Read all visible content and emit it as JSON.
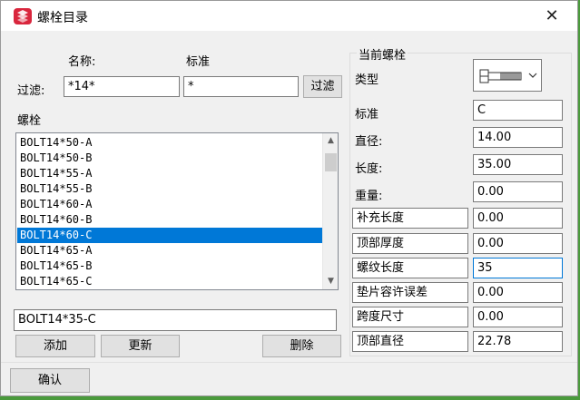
{
  "window": {
    "title": "螺栓目录",
    "close_symbol": "✕"
  },
  "filter": {
    "name_header": "名称:",
    "standard_header": "标准",
    "label": "过滤:",
    "name_value": "*14*",
    "standard_value": "*",
    "button": "过滤"
  },
  "bolts": {
    "label": "螺栓",
    "items": [
      "BOLT14*50-A",
      "BOLT14*50-B",
      "BOLT14*55-A",
      "BOLT14*55-B",
      "BOLT14*60-A",
      "BOLT14*60-B",
      "BOLT14*60-C",
      "BOLT14*65-A",
      "BOLT14*65-B",
      "BOLT14*65-C"
    ],
    "selected_index": 6,
    "current_name": "BOLT14*35-C"
  },
  "actions": {
    "add": "添加",
    "update": "更新",
    "delete": "删除",
    "confirm": "确认"
  },
  "current": {
    "group_title": "当前螺栓",
    "type_label": "类型",
    "type_icon": "bolt-icon",
    "standard_label": "标准",
    "standard_value": "C",
    "diameter_label": "直径:",
    "diameter_value": "14.00",
    "length_label": "长度:",
    "length_value": "35.00",
    "weight_label": "重量:",
    "weight_value": "0.00",
    "extra_length_label": "补充长度",
    "extra_length_value": "0.00",
    "top_thickness_label": "顶部厚度",
    "top_thickness_value": "0.00",
    "thread_length_label": "螺纹长度",
    "thread_length_value": "35",
    "washer_tolerance_label": "垫片容许误差",
    "washer_tolerance_value": "0.00",
    "span_label": "跨度尺寸",
    "span_value": "0.00",
    "top_diameter_label": "顶部直径",
    "top_diameter_value": "22.78"
  },
  "colors": {
    "selection": "#0078d7",
    "app_icon": "#d9263d"
  }
}
